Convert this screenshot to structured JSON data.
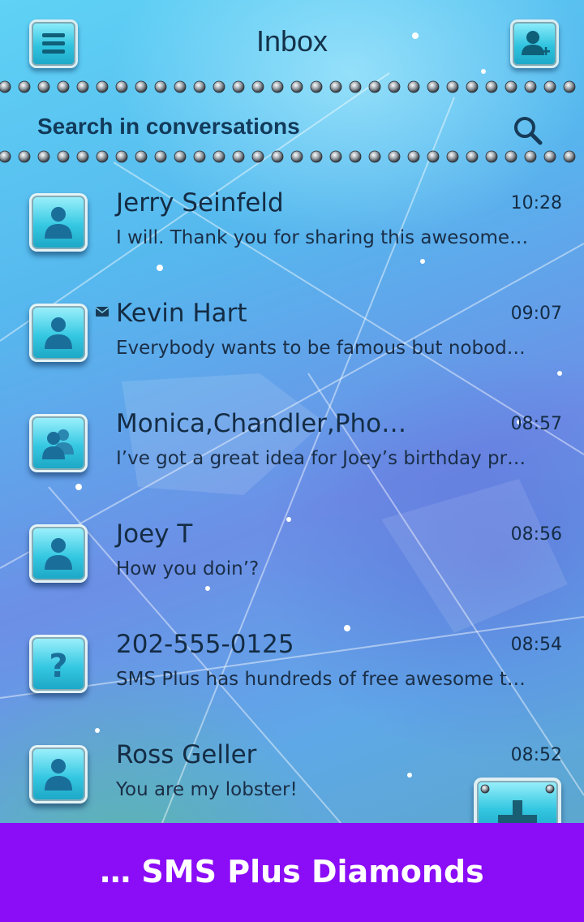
{
  "header": {
    "title": "Inbox",
    "menu_icon": "hamburger-menu-icon",
    "new_contact_icon": "add-contact-icon"
  },
  "search": {
    "placeholder": "Search in conversations",
    "icon": "search-icon"
  },
  "conversations": [
    {
      "name": "Jerry Seinfeld",
      "time": "10:28",
      "preview": "I will. Thank you for sharing this awesome…",
      "avatar": "person-icon",
      "unread": false
    },
    {
      "name": "Kevin Hart",
      "time": "09:07",
      "preview": "Everybody wants to be famous but nobod…",
      "avatar": "person-icon",
      "unread": true
    },
    {
      "name": "Monica,Chandler,Pho…",
      "time": "08:57",
      "preview": "I’ve got a great idea for Joey’s birthday pr…",
      "avatar": "group-icon",
      "unread": false
    },
    {
      "name": "Joey T",
      "time": "08:56",
      "preview": "How you doin’?",
      "avatar": "person-icon",
      "unread": false
    },
    {
      "name": "202-555-0125",
      "time": "08:54",
      "preview": "SMS Plus has hundreds of free awesome t…",
      "avatar": "unknown-contact-icon",
      "unread": false
    },
    {
      "name": "Ross Geller",
      "time": "08:52",
      "preview": " You are my lobster!",
      "avatar": "person-icon",
      "unread": false
    }
  ],
  "fab": {
    "icon": "plus-icon"
  },
  "banner": {
    "text": "… SMS Plus Diamonds"
  },
  "colors": {
    "banner": "#8b0cf6",
    "text": "#142c44",
    "button_teal": "#2fc3df"
  }
}
